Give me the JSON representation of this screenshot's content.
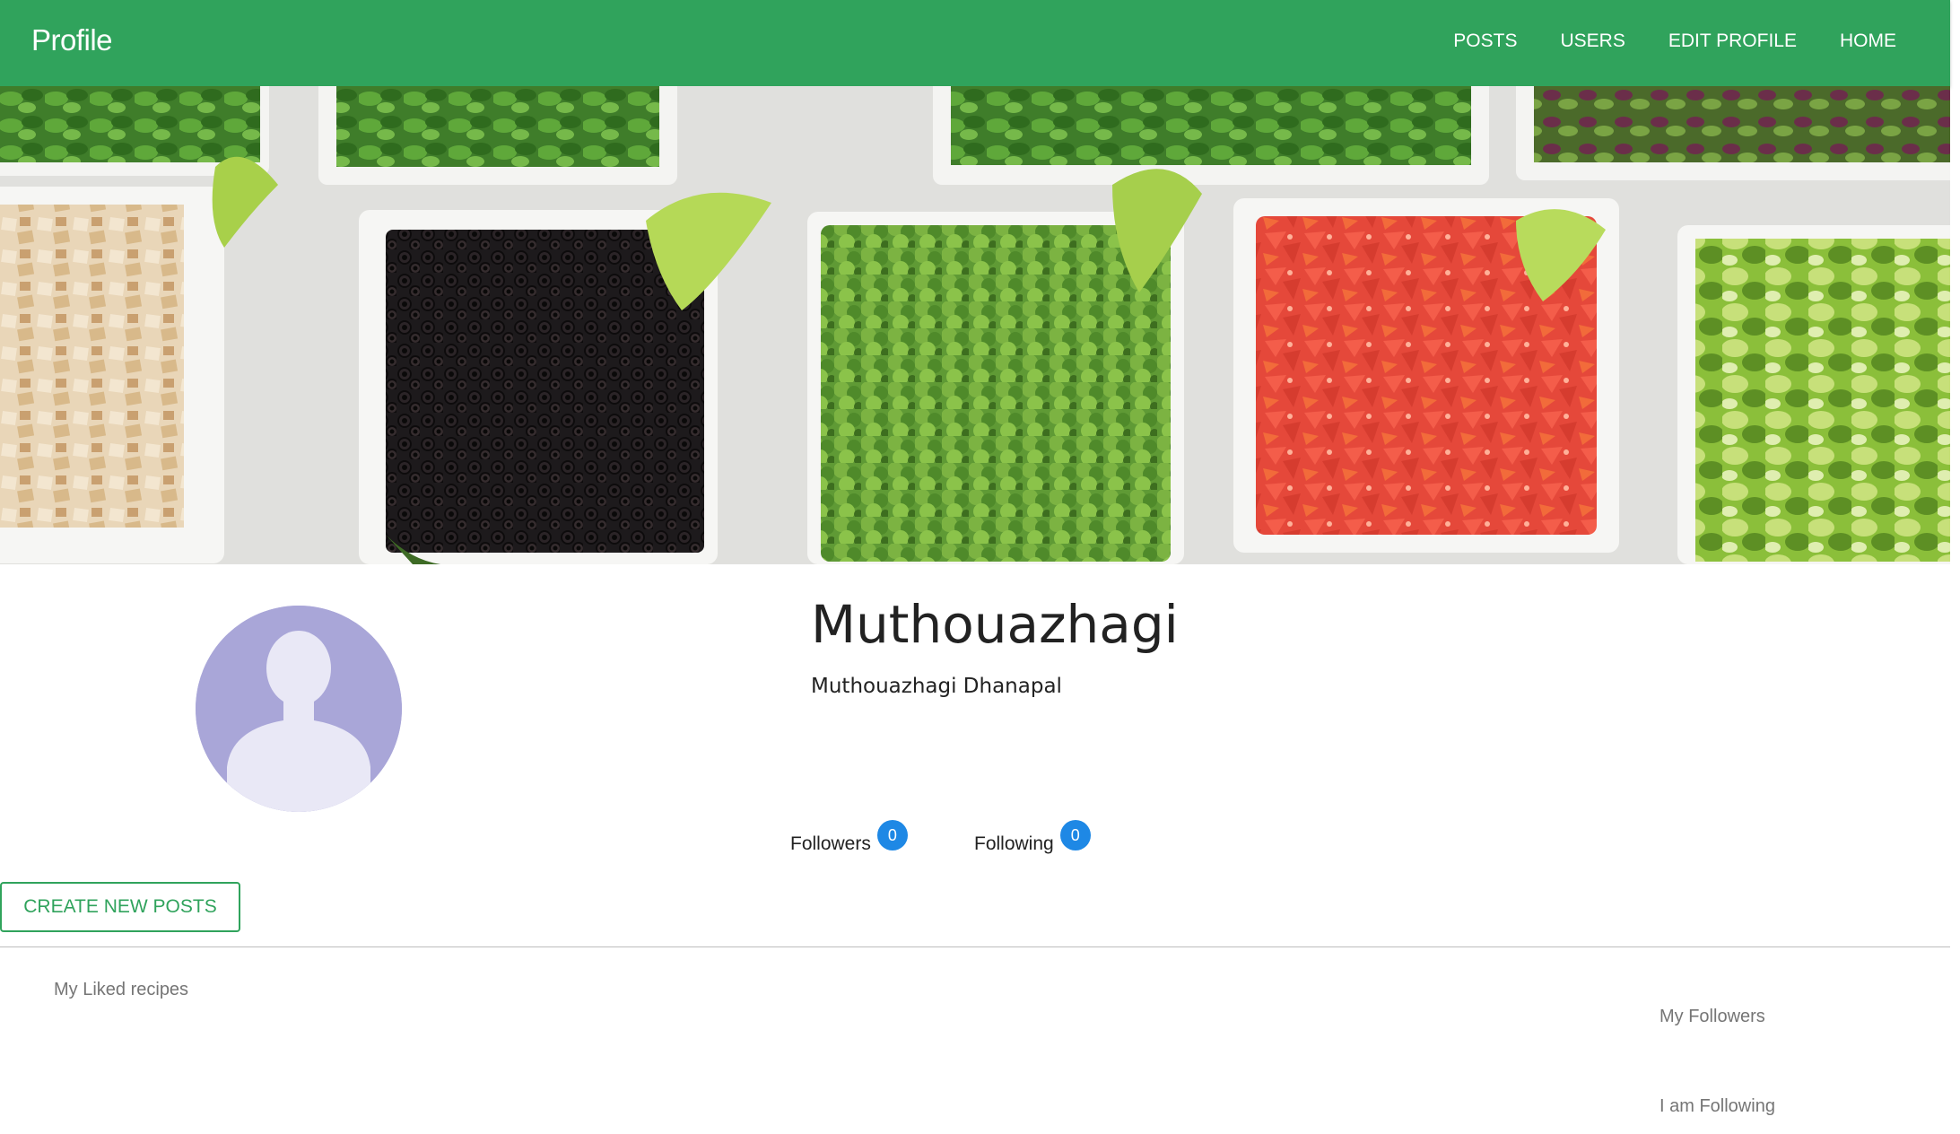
{
  "navbar": {
    "brand": "Profile",
    "links": [
      "POSTS",
      "USERS",
      "EDIT PROFILE",
      "HOME"
    ],
    "color": "#30a35c"
  },
  "banner": {
    "image": "salad-bar-vegetables-photo"
  },
  "profile": {
    "avatar_icon": "person-silhouette-icon",
    "username": "Muthouazhagi",
    "full_name": "Muthouazhagi Dhanapal",
    "followers_label": "Followers",
    "followers_count": "0",
    "following_label": "Following",
    "following_count": "0"
  },
  "actions": {
    "create_post_label": "CREATE NEW POSTS"
  },
  "sections": {
    "liked_recipes": "My Liked recipes",
    "my_followers": "My Followers",
    "i_am_following": "I am Following"
  },
  "colors": {
    "primary": "#30a35c",
    "badge": "#1e88e5"
  }
}
